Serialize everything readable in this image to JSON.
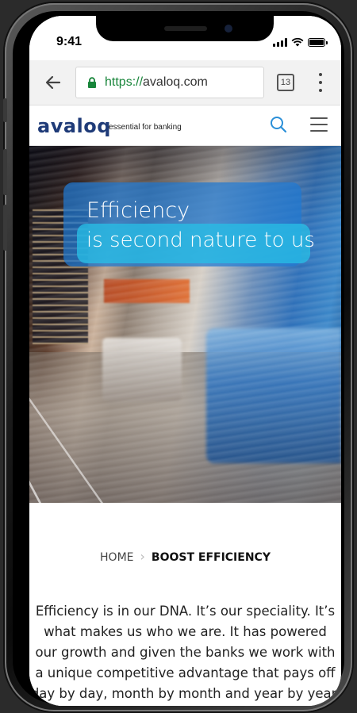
{
  "status_bar": {
    "time": "9:41"
  },
  "browser": {
    "url_scheme": "https://",
    "url_host": "avaloq.com",
    "tab_count": "13"
  },
  "site_header": {
    "logo": "avaloq",
    "tagline": "essential for banking"
  },
  "hero": {
    "headline_line1": "Efficiency",
    "headline_line2": "is second nature to us"
  },
  "breadcrumb": {
    "home": "HOME",
    "separator": "›",
    "current": "BOOST EFFICIENCY"
  },
  "intro": {
    "lines": [
      "Efficiency is in our DNA. It’s our speciality. It’s",
      "what makes us who we are. It has powered",
      "our growth and given the banks we work with",
      "a unique competitive advantage that pays off",
      "day by day, month by month and year by year."
    ]
  },
  "colors": {
    "brand": "#1f3b78",
    "secure_url": "#18853a",
    "hero_blue": "#1e78d2",
    "hero_cyan": "#28bee6"
  }
}
